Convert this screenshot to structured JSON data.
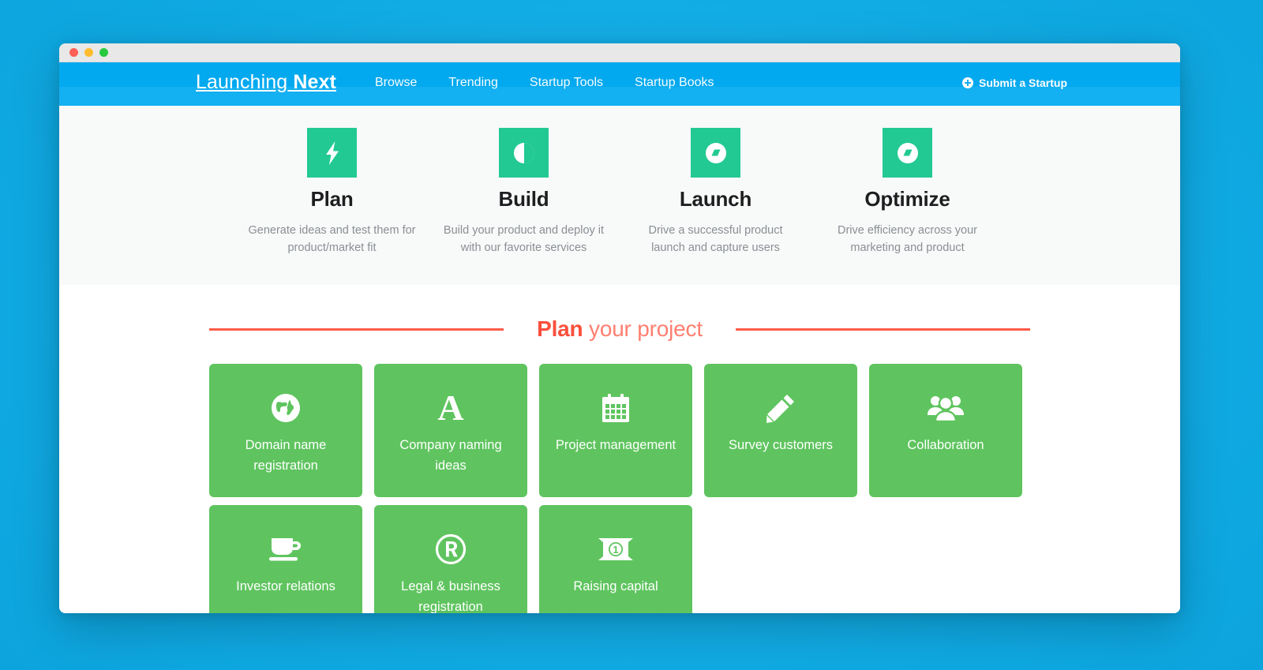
{
  "window": {
    "traffic_lights": [
      "close",
      "minimize",
      "maximize"
    ]
  },
  "nav": {
    "brand_light": "Launching",
    "brand_bold": "Next",
    "links": [
      {
        "label": "Browse",
        "name": "browse"
      },
      {
        "label": "Trending",
        "name": "trending"
      },
      {
        "label": "Startup Tools",
        "name": "startup-tools"
      },
      {
        "label": "Startup Books",
        "name": "startup-books"
      }
    ],
    "submit_label": "Submit a Startup",
    "submit_icon": "plus-circle-icon",
    "bg_color": "#03a9ef",
    "bg_color_lower": "#13b0f2"
  },
  "features": [
    {
      "icon": "bolt-icon",
      "title": "Plan",
      "desc_line1": "Generate ideas and test them for",
      "desc_line2": "product/market fit"
    },
    {
      "icon": "contrast-icon",
      "title": "Build",
      "desc_line1": "Build your product and deploy it",
      "desc_line2": "with our favorite services"
    },
    {
      "icon": "compass-icon",
      "title": "Launch",
      "desc_line1": "Drive a successful product",
      "desc_line2": "launch and capture users"
    },
    {
      "icon": "compass-icon",
      "title": "Optimize",
      "desc_line1": "Drive efficiency across your",
      "desc_line2": "marketing and product"
    }
  ],
  "section": {
    "title_bold": "Plan",
    "title_light": " your project",
    "rule_color": "#ff5a4a",
    "title_color": "#ff7f70"
  },
  "cards": [
    {
      "icon": "globe-icon",
      "label_line1": "Domain name",
      "label_line2": "registration"
    },
    {
      "icon": "letter-a-icon",
      "label_line1": "Company naming",
      "label_line2": "ideas"
    },
    {
      "icon": "calendar-icon",
      "label_line1": "Project management",
      "label_line2": ""
    },
    {
      "icon": "pencil-icon",
      "label_line1": "Survey customers",
      "label_line2": ""
    },
    {
      "icon": "users-icon",
      "label_line1": "Collaboration",
      "label_line2": ""
    },
    {
      "icon": "coffee-icon",
      "label_line1": "Investor relations",
      "label_line2": ""
    },
    {
      "icon": "registered-trademark-icon",
      "label_line1": "Legal & business",
      "label_line2": "registration"
    },
    {
      "icon": "money-bill-icon",
      "label_line1": "Raising capital",
      "label_line2": ""
    }
  ],
  "colors": {
    "page_background": "#12b0ec",
    "feature_icon": "#22c993",
    "card": "#5fc45f",
    "features_band": "#f8f9f9"
  }
}
